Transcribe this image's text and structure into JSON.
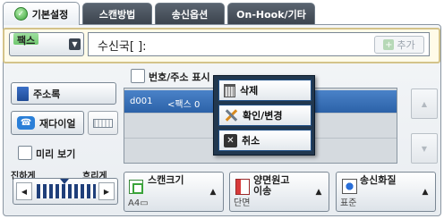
{
  "tabs": [
    {
      "label": "기본설정",
      "active": true
    },
    {
      "label": "스캔방법",
      "active": false
    },
    {
      "label": "송신옵션",
      "active": false
    },
    {
      "label": "On-Hook/기타",
      "active": false
    }
  ],
  "fax_row": {
    "type_label": "팩스",
    "recipient_text": "수신국[     ]:",
    "add_label": "추가"
  },
  "left": {
    "address_book_label": "주소록",
    "redial_label": "재다이얼",
    "preview_label": "미리 보기"
  },
  "number_address_display_label": "번호/주소 표시",
  "list": {
    "rows": [
      {
        "id": "d001",
        "name": "<팩스 0"
      },
      {
        "id": "",
        "name": ""
      },
      {
        "id": "",
        "name": ""
      }
    ]
  },
  "popup": {
    "delete_label": "삭제",
    "confirm_change_label": "확인/변경",
    "cancel_label": "취소"
  },
  "contrast": {
    "lighter_label": "진하게",
    "darker_label": "흐리게"
  },
  "bottom": {
    "scan_size": {
      "title": "스캔크기",
      "value": "A4▭"
    },
    "duplex": {
      "title": "양면원고\n이송",
      "value": "단면"
    },
    "quality": {
      "title": "송신화질",
      "value": "표준"
    }
  },
  "colors": {
    "tab_dark": "#3c444e",
    "selected_row": "#2c62a8",
    "popup_bg": "#22384f",
    "fax_row_border": "#d4c38a"
  }
}
